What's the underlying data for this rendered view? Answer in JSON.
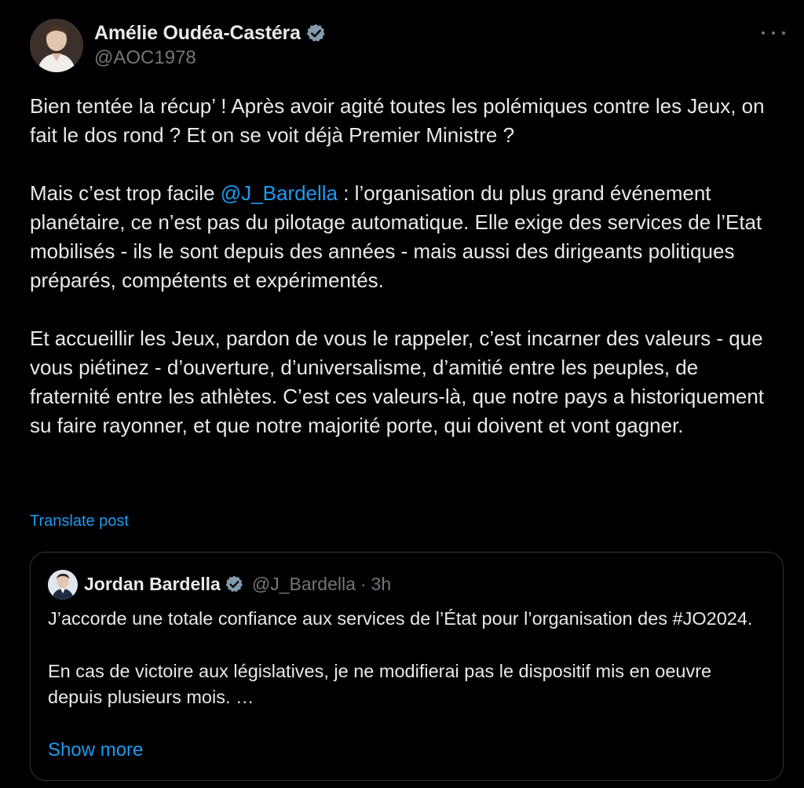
{
  "post": {
    "display_name": "Amélie Oudéa-Castéra",
    "handle": "@AOC1978",
    "verified_icon": "verified-badge-icon",
    "more_icon": "more-options-icon",
    "paragraph_1": "Bien tentée la récup’ ! Après avoir agité toutes les polémiques contre les Jeux, on fait le dos rond ? Et on se voit déjà Premier Ministre ?",
    "paragraph_2_before": "Mais c’est trop facile ",
    "paragraph_2_mention": "@J_Bardella",
    "paragraph_2_after": " : l’organisation du plus grand événement planétaire, ce n’est pas du pilotage automatique. Elle exige des services de l’Etat mobilisés - ils le sont depuis des années - mais aussi des dirigeants politiques préparés, compétents et expérimentés.",
    "paragraph_3": "Et accueillir les Jeux, pardon de vous le rappeler, c’est incarner des valeurs - que vous piétinez - d’ouverture, d’universalisme, d’amitié entre les peuples, de fraternité entre les athlètes. C’est ces valeurs-là, que notre pays a historiquement su faire rayonner, et que notre majorité porte, qui doivent et vont gagner.",
    "translate_label": "Translate post"
  },
  "quote": {
    "display_name": "Jordan Bardella",
    "handle": "@J_Bardella",
    "separator": "·",
    "time": "3h",
    "paragraph_1": "J’accorde une totale confiance aux services de l’État pour l’organisation des #JO2024.",
    "paragraph_2": "En cas de victoire aux législatives, je ne modifierai pas le dispositif mis en oeuvre depuis plusieurs mois. …",
    "show_more_label": "Show more"
  },
  "colors": {
    "background": "#000000",
    "text": "#e7e9ea",
    "secondary": "#71767b",
    "accent": "#1d9bf0",
    "border": "#2f3336"
  }
}
